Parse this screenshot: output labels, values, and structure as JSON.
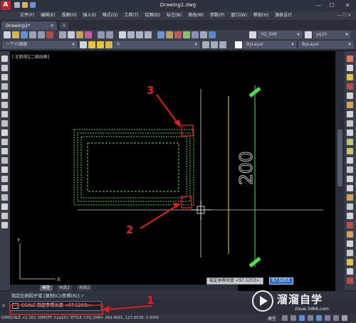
{
  "window": {
    "logo": "A",
    "title": "Drawing1.dwg",
    "minimize": "—",
    "maximize": "☐",
    "close": "✕"
  },
  "menu": {
    "items": [
      "文件(F)",
      "编辑(E)",
      "视图(V)",
      "插入(I)",
      "格式(O)",
      "工具(T)",
      "绘图(D)",
      "标注(N)",
      "修改(M)",
      "参数(P)",
      "窗口(W)",
      "帮助(H)",
      "源泉设计"
    ],
    "window_controls": "— ☐ ✕"
  },
  "tabs": {
    "active": "Drawing1*",
    "close": "✕",
    "new": "+"
  },
  "toolbar": {
    "dimstyle_combo": "YQ_DIM",
    "textstyle_combo": "yq10",
    "layer_state_combo": "一个川源器",
    "layer_combo": "0",
    "color_combo": "ByLayer",
    "linetype_combo": "ByLayer"
  },
  "canvas": {
    "viewport_label": "[-][俯视][二维线框]",
    "dimension_text": "200",
    "annotations": [
      "1",
      "2",
      "3"
    ]
  },
  "dynamic_input": {
    "label": "指定参照长度 <97.5203>:",
    "value": "97.5203"
  },
  "layout_tabs": [
    "模型",
    "布局1",
    "布局2"
  ],
  "command": {
    "history": "指定比例因子或 [复制(C)/参照(R)]: r",
    "current": "SCALE 指定参照长度 <97.5203>:",
    "close": "✕"
  },
  "status": {
    "text": "DIMSCALE <1.10> DIMSTY <yq10> STYLE <YQ_DIM>  269.6691, 127.6538, 0.0000",
    "model": "模型"
  },
  "watermark": {
    "brand": "溜溜自学",
    "url": "zixue.3d66.com"
  },
  "colors": {
    "drawing_lines": "#5fd35f",
    "annotation_red": "#e0201e",
    "command_highlight": "#2b6cc4"
  }
}
